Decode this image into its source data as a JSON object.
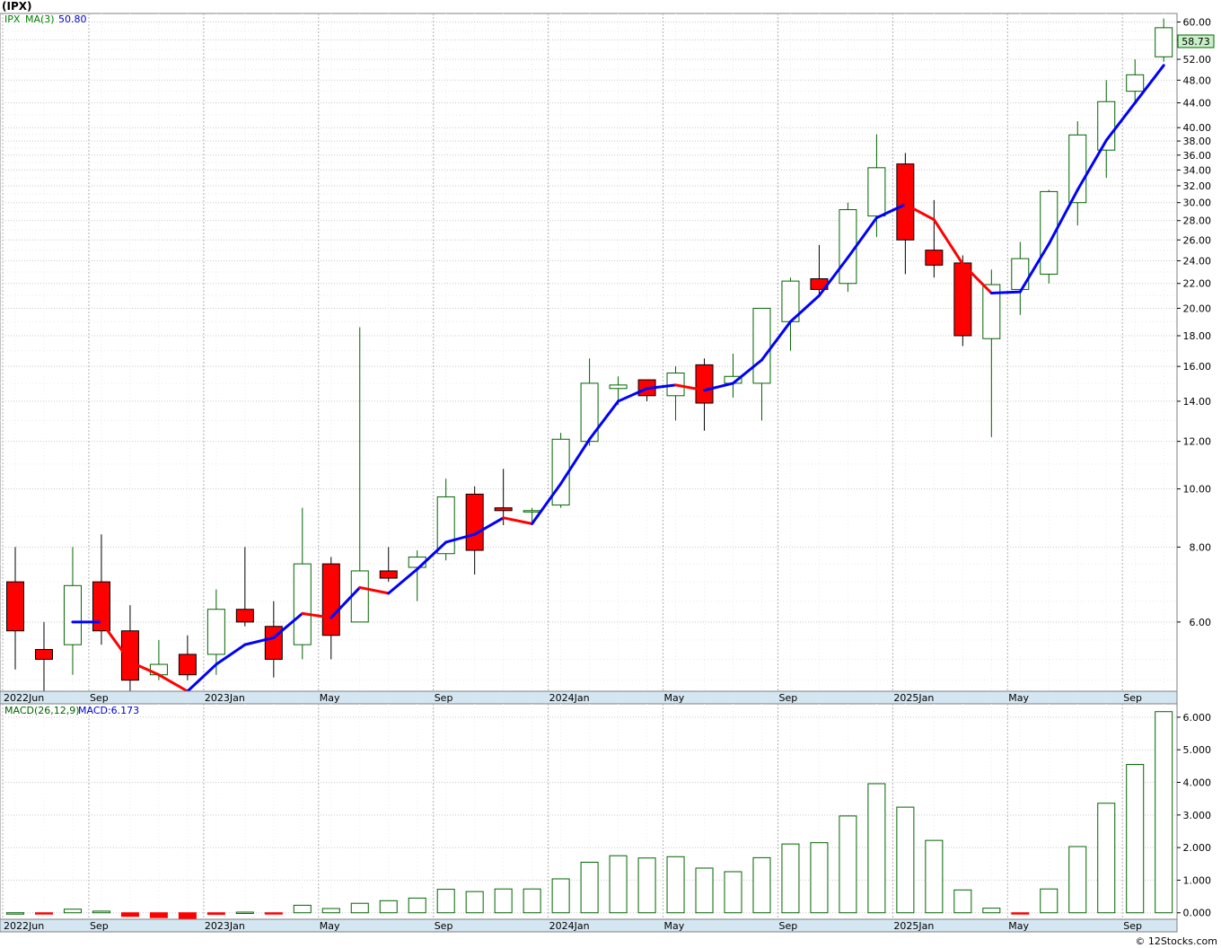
{
  "title": "(IPX)",
  "copyright": "© 12Stocks.com",
  "colors": {
    "up": "#006400",
    "down": "#ff0000",
    "ma_up": "#0000ff",
    "ma_down": "#ff0000",
    "grid": "#c8c8c8",
    "axis_bg": "#d4e6f1"
  },
  "price_panel": {
    "ticker_label": "IPX",
    "ma_label": "MA(3)",
    "ma_value": "50.80",
    "last_price_label": "58.73"
  },
  "macd_panel": {
    "label": "MACD(26,12,9)",
    "value_label": "MACD:6.173"
  },
  "chart_data": [
    {
      "type": "candlestick",
      "scale": "log",
      "ylim": [
        4.6,
        62
      ],
      "y_ticks": [
        6,
        8,
        10,
        12,
        14,
        16,
        18,
        20,
        22,
        24,
        26,
        28,
        30,
        32,
        34,
        36,
        38,
        40,
        44,
        48,
        52,
        56,
        60
      ],
      "y_tick_labels": [
        "6.00",
        "8.00",
        "10.00",
        "12.00",
        "14.00",
        "16.00",
        "18.00",
        "20.00",
        "22.00",
        "24.00",
        "26.00",
        "28.00",
        "30.00",
        "32.00",
        "34.00",
        "36.00",
        "38.00",
        "40.00",
        "44.00",
        "48.00",
        "52.00",
        "",
        "60.00"
      ],
      "x_labels": [
        "2022Jun",
        "Sep",
        "2023Jan",
        "May",
        "Sep",
        "2024Jan",
        "May",
        "Sep",
        "2025Jan",
        "May",
        "Sep"
      ],
      "x_label_index": [
        0,
        3,
        7,
        11,
        15,
        19,
        23,
        27,
        31,
        35,
        39
      ],
      "ohlc": [
        [
          7.0,
          8.0,
          5.0,
          5.8
        ],
        [
          5.4,
          6.0,
          4.4,
          5.2
        ],
        [
          5.5,
          8.0,
          4.9,
          6.9
        ],
        [
          7.0,
          8.4,
          5.5,
          5.8
        ],
        [
          5.8,
          6.4,
          4.6,
          4.8
        ],
        [
          4.9,
          5.6,
          4.8,
          5.1
        ],
        [
          5.3,
          5.7,
          4.8,
          4.9
        ],
        [
          5.3,
          6.8,
          4.9,
          6.3
        ],
        [
          6.3,
          8.0,
          5.9,
          6.0
        ],
        [
          5.9,
          6.5,
          4.85,
          5.2
        ],
        [
          5.5,
          9.3,
          5.2,
          7.5
        ],
        [
          7.5,
          7.7,
          5.2,
          5.7
        ],
        [
          6.0,
          18.6,
          6.0,
          7.3
        ],
        [
          7.3,
          8.0,
          7.0,
          7.1
        ],
        [
          7.4,
          7.9,
          6.5,
          7.7
        ],
        [
          7.8,
          10.4,
          7.6,
          9.7
        ],
        [
          9.8,
          10.1,
          7.2,
          7.9
        ],
        [
          9.3,
          10.8,
          8.7,
          9.2
        ],
        [
          9.2,
          9.3,
          8.7,
          9.2
        ],
        [
          9.4,
          12.4,
          9.3,
          12.1
        ],
        [
          12.0,
          16.5,
          11.8,
          15.0
        ],
        [
          14.7,
          15.4,
          13.8,
          14.9
        ],
        [
          15.2,
          15.2,
          14.0,
          14.3
        ],
        [
          14.3,
          16.0,
          13.0,
          15.6
        ],
        [
          16.1,
          16.5,
          12.5,
          13.9
        ],
        [
          15.0,
          16.8,
          14.2,
          15.4
        ],
        [
          15.0,
          20.0,
          13.0,
          20.0
        ],
        [
          19.0,
          22.5,
          17.0,
          22.2
        ],
        [
          22.4,
          25.5,
          21.0,
          21.5
        ],
        [
          22.0,
          30.0,
          21.3,
          29.2
        ],
        [
          28.5,
          39.0,
          26.3,
          34.3
        ],
        [
          34.8,
          36.3,
          22.8,
          26.0
        ],
        [
          25.0,
          30.3,
          22.5,
          23.6
        ],
        [
          23.8,
          24.5,
          17.3,
          18.0
        ],
        [
          17.8,
          23.2,
          12.2,
          21.9
        ],
        [
          21.5,
          25.8,
          19.5,
          24.2
        ],
        [
          22.8,
          31.5,
          22.0,
          31.3
        ],
        [
          30.0,
          41.0,
          27.5,
          38.9
        ],
        [
          36.7,
          48.0,
          33.0,
          44.2
        ],
        [
          46.0,
          52.0,
          44.0,
          49.0
        ],
        [
          52.5,
          60.8,
          51.5,
          58.7
        ]
      ],
      "ma3": [
        null,
        null,
        6.0,
        6.0,
        5.15,
        4.9,
        4.6,
        5.1,
        5.5,
        5.65,
        6.2,
        6.1,
        6.85,
        6.7,
        7.35,
        8.15,
        8.4,
        8.95,
        8.75,
        10.2,
        12.1,
        14.0,
        14.7,
        14.9,
        14.6,
        15.0,
        16.4,
        19.0,
        21.0,
        24.3,
        28.3,
        29.8,
        28.1,
        23.7,
        21.2,
        21.3,
        25.6,
        31.5,
        38.1,
        44.0,
        50.8
      ]
    },
    {
      "type": "bar",
      "ylim": [
        -0.2,
        6.3
      ],
      "y_ticks": [
        0,
        1,
        2,
        3,
        4,
        5,
        6
      ],
      "y_tick_labels": [
        "0.000",
        "1.000",
        "2.000",
        "3.000",
        "4.000",
        "5.000",
        "6.000"
      ],
      "x_labels": [
        "2022Jun",
        "Sep",
        "2023Jan",
        "May",
        "Sep",
        "2024Jan",
        "May",
        "Sep",
        "2025Jan",
        "May",
        "Sep"
      ],
      "values": [
        0.0,
        -0.03,
        0.11,
        0.05,
        -0.11,
        -0.15,
        -0.21,
        -0.05,
        0.02,
        -0.03,
        0.23,
        0.13,
        0.29,
        0.37,
        0.45,
        0.72,
        0.65,
        0.73,
        0.73,
        1.04,
        1.55,
        1.75,
        1.68,
        1.72,
        1.37,
        1.26,
        1.69,
        2.11,
        2.15,
        2.97,
        3.96,
        3.24,
        2.22,
        0.7,
        0.14,
        -0.03,
        0.73,
        2.03,
        3.36,
        4.55,
        6.17
      ]
    }
  ]
}
